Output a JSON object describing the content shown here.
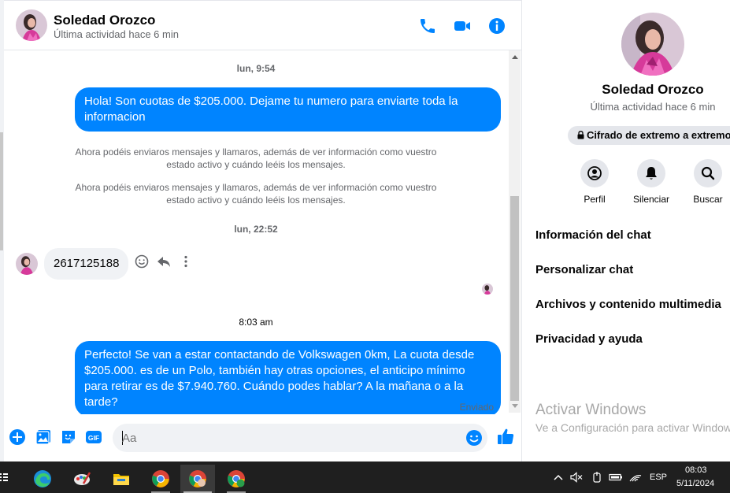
{
  "contact": {
    "name": "Soledad Orozco",
    "status": "Última actividad hace 6 min"
  },
  "messages": {
    "ts1": "lun, 9:54",
    "out1": "Hola! Son cuotas de $205.000. Dejame tu numero para enviarte toda la informacion",
    "sys1": "Ahora podéis enviaros mensajes y llamaros, además de ver información como vuestro estado activo y cuándo leéis los mensajes.",
    "sys2": "Ahora podéis enviaros mensajes y llamaros, además de ver información como vuestro estado activo y cuándo leéis los mensajes.",
    "ts2": "lun, 22:52",
    "in1": "2617125188",
    "ts3": "8:03 am",
    "out2": "Perfecto!  Se van a estar contactando de Volkswagen 0km, La cuota desde $205.000. es de un Polo, también hay otras opciones, el anticipo mínimo para retirar es de $7.940.760. Cuándo podes hablar? A la mañana o a la tarde?",
    "sent_label": "Enviado"
  },
  "composer": {
    "placeholder": "Aa"
  },
  "info_panel": {
    "encryption": "Cifrado de extremo a extremo",
    "actions": [
      "Perfil",
      "Silenciar",
      "Buscar"
    ],
    "sections": [
      "Información del chat",
      "Personalizar chat",
      "Archivos y contenido multimedia",
      "Privacidad y ayuda"
    ]
  },
  "watermark": {
    "title": "Activar Windows",
    "subtitle": "Ve a Configuración para activar Windows."
  },
  "taskbar": {
    "lang": "ESP",
    "time": "08:03",
    "date": "5/11/2024"
  },
  "colors": {
    "accent": "#0084ff",
    "bubble_in": "#f0f2f5",
    "secondary_text": "#65676b"
  }
}
